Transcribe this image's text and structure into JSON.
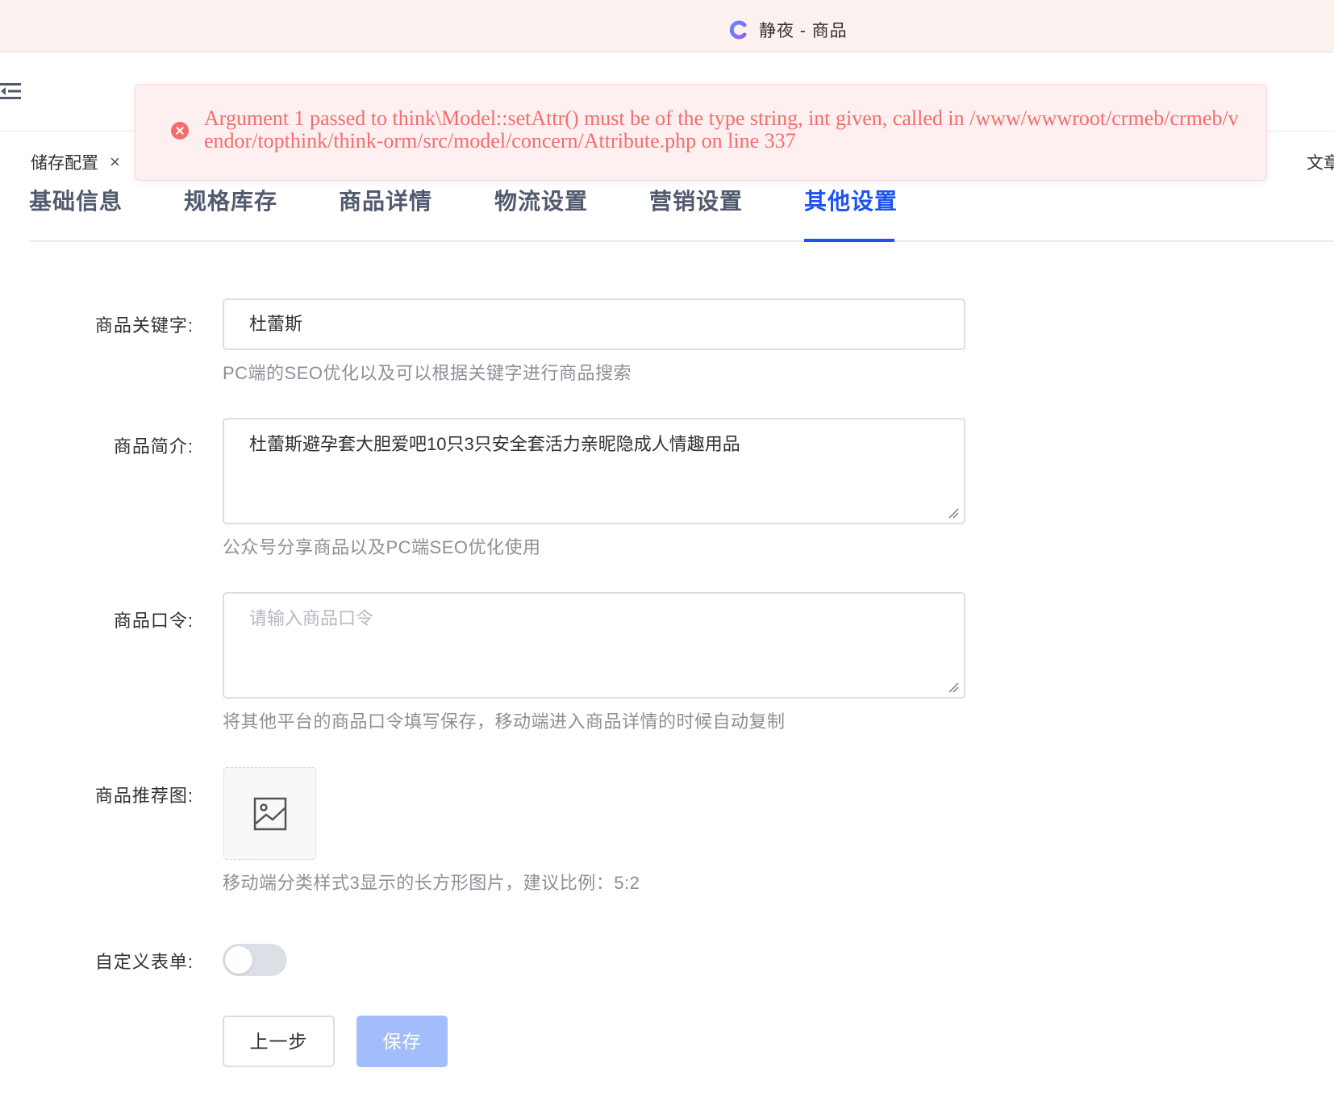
{
  "window": {
    "title": "静夜 - 商品"
  },
  "alert": {
    "message": "Argument 1 passed to think\\Model::setAttr() must be of the type string, int given, called in /www/wwwroot/crmeb/crmeb/vendor/topthink/think-orm/src/model/concern/Attribute.php on line 337",
    "color": "#f56c6c"
  },
  "tagbar": {
    "active_tag": "储存配置",
    "close_symbol": "×",
    "right_tag_partial": "文章"
  },
  "tabs": [
    {
      "label": "基础信息"
    },
    {
      "label": "规格库存"
    },
    {
      "label": "商品详情"
    },
    {
      "label": "物流设置"
    },
    {
      "label": "营销设置"
    },
    {
      "label": "其他设置"
    }
  ],
  "active_tab": "其他设置",
  "accent_color": "#1d54f0",
  "form": {
    "keyword": {
      "label": "商品关键字:",
      "value": "杜蕾斯",
      "hint": "PC端的SEO优化以及可以根据关键字进行商品搜索"
    },
    "intro": {
      "label": "商品简介:",
      "value": "杜蕾斯避孕套大胆爱吧10只3只安全套活力亲昵隐成人情趣用品",
      "hint": "公众号分享商品以及PC端SEO优化使用"
    },
    "command": {
      "label": "商品口令:",
      "value": "",
      "placeholder": "请输入商品口令",
      "hint": "将其他平台的商品口令填写保存，移动端进入商品详情的时候自动复制"
    },
    "recommend_image": {
      "label": "商品推荐图:",
      "icon": "image-placeholder-icon",
      "hint": "移动端分类样式3显示的长方形图片，建议比例：5:2"
    },
    "custom_form": {
      "label": "自定义表单:",
      "enabled": false
    }
  },
  "buttons": {
    "prev": "上一步",
    "save": "保存"
  }
}
